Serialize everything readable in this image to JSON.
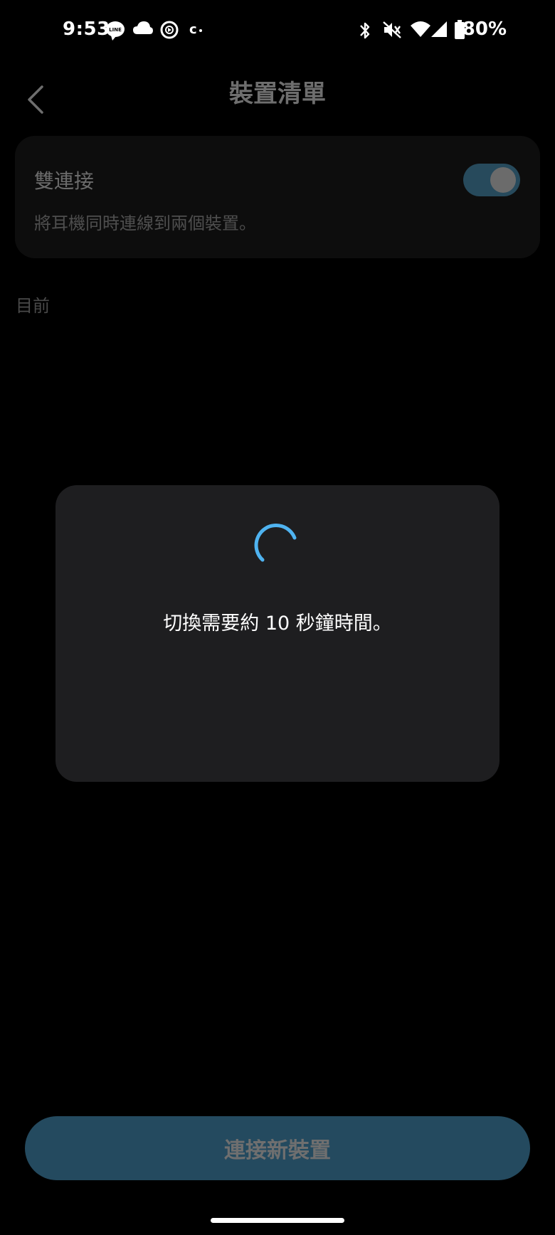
{
  "status_bar": {
    "time": "9:53",
    "battery": "80%",
    "icons": [
      "line-icon",
      "cloud-icon",
      "play-circle-icon",
      "c-dot-icon",
      "bluetooth-icon",
      "mute-icon",
      "wifi-icon",
      "signal-icon",
      "battery-icon"
    ]
  },
  "header": {
    "title": "裝置清單"
  },
  "dual_connection": {
    "title": "雙連接",
    "description": "將耳機同時連線到兩個裝置。",
    "enabled": true
  },
  "section": {
    "current_label": "目前"
  },
  "dialog": {
    "message": "切換需要約 10 秒鐘時間。"
  },
  "footer": {
    "connect_label": "連接新裝置"
  },
  "colors": {
    "accent": "#4fb3f0",
    "button_bg": "#244a5f",
    "dialog_bg": "#1e1e20"
  }
}
